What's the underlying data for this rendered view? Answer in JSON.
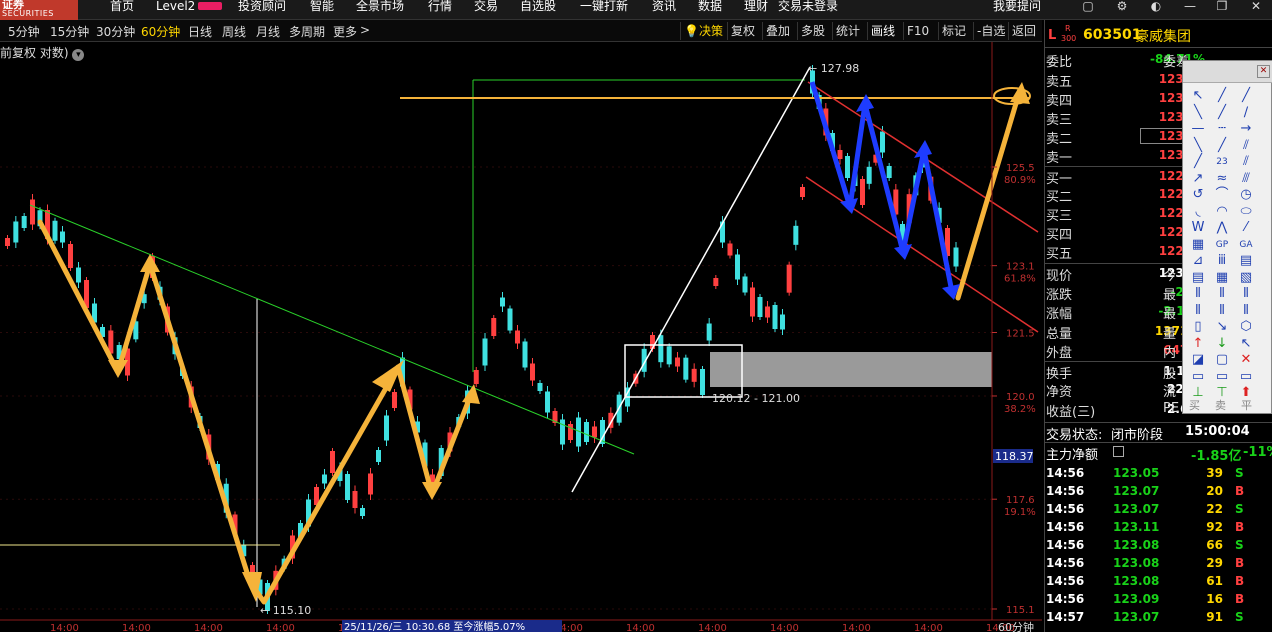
{
  "app": {
    "logo_line1": "证券",
    "logo_line2": "SECURITIES",
    "menu": [
      "首页",
      "Level2",
      "投资顾问",
      "智能",
      "全景市场",
      "行情",
      "交易",
      "自选股",
      "一键打新",
      "资讯",
      "数据",
      "理财",
      "交易未登录",
      "我要提问"
    ]
  },
  "toolbar": {
    "periods": [
      "5分钟",
      "15分钟",
      "30分钟",
      "60分钟",
      "日线",
      "周线",
      "月线",
      "多周期",
      "更多"
    ],
    "active_period": "60分钟",
    "more_arrow": ">",
    "right_buttons": [
      "决策",
      "复权",
      "叠加",
      "多股",
      "统计",
      "画线",
      "F10",
      "标记",
      "-自选",
      "返回"
    ],
    "active_right": "画线"
  },
  "chart": {
    "subtitle": "前复权 对数)",
    "annotations": {
      "high": "127.98",
      "low": "115.10",
      "box_range": "120.12 - 121.00",
      "current_price": "118.37",
      "cursor_info": "25/11/26/三 10:30.68 至今涨幅5.07%"
    },
    "price_axis": [
      {
        "price": "125.5",
        "pct": "80.9%"
      },
      {
        "price": "123.1",
        "pct": "61.8%"
      },
      {
        "price": "121.5",
        "pct": ""
      },
      {
        "price": "120.0",
        "pct": "38.2%"
      },
      {
        "price": "117.6",
        "pct": "19.1%"
      },
      {
        "price": "115.1",
        "pct": ""
      }
    ],
    "time_axis": [
      "14:00",
      "14:00",
      "14:00",
      "14:00",
      "14:00",
      "14:00",
      "14:00",
      "14:00",
      "14:00",
      "14:00",
      "14:00",
      "14:00",
      "14:00",
      "14:00"
    ],
    "period_label": "60分钟",
    "colors": {
      "up": "#ff4040",
      "down": "#3fe0e0",
      "arrow": "#f5b33a",
      "blue_arrow": "#1e3cff"
    }
  },
  "stock": {
    "badge_top": "R",
    "badge_bottom": "300",
    "market": "L",
    "code": "603501",
    "name": "豪威集团",
    "webi_label": "委比",
    "webi_value": "-84.71%",
    "webi_ext": "委差",
    "asks": [
      {
        "label": "卖五",
        "price": "123.04"
      },
      {
        "label": "卖四",
        "price": "123.03"
      },
      {
        "label": "卖三",
        "price": "123.02"
      },
      {
        "label": "卖二",
        "price": "123.01"
      },
      {
        "label": "卖一",
        "price": "123.00"
      }
    ],
    "bids": [
      {
        "label": "买一",
        "price": "122.99"
      },
      {
        "label": "买二",
        "price": "122.98"
      },
      {
        "label": "买三",
        "price": "122.95"
      },
      {
        "label": "买四",
        "price": "122.94"
      },
      {
        "label": "买五",
        "price": "122.93"
      }
    ],
    "stats": [
      {
        "label": "现价",
        "value": "123.00",
        "ext": "今",
        "color": "wht"
      },
      {
        "label": "涨跌",
        "value": "-2.74",
        "ext": "最",
        "color": "grn"
      },
      {
        "label": "涨幅",
        "value": "-2.18%",
        "ext": "最",
        "color": "grn"
      },
      {
        "label": "总量",
        "value": "137134",
        "ext": "量",
        "color": "yel"
      },
      {
        "label": "外盘",
        "value": "64761",
        "ext": "内",
        "color": "red"
      },
      {
        "label": "换手",
        "value": "1.13%",
        "ext": "股",
        "color": "wht"
      },
      {
        "label": "净资",
        "value": "22.77",
        "ext": "流",
        "color": "wht"
      },
      {
        "label": "收益(三)",
        "value": "2.670",
        "ext": "PE",
        "color": "wht"
      }
    ],
    "trade_status_label": "交易状态:",
    "trade_status_value": "闭市阶段",
    "trade_status_time": "15:00:04",
    "main_flow_label": "主力净额",
    "main_flow_value": "-1.85亿",
    "main_flow_pct": "-11%",
    "ticks": [
      {
        "time": "14:56",
        "price": "123.05",
        "vol": "39",
        "side": "S"
      },
      {
        "time": "14:56",
        "price": "123.07",
        "vol": "20",
        "side": "B"
      },
      {
        "time": "14:56",
        "price": "123.07",
        "vol": "22",
        "side": "S"
      },
      {
        "time": "14:56",
        "price": "123.11",
        "vol": "92",
        "side": "B"
      },
      {
        "time": "14:56",
        "price": "123.08",
        "vol": "66",
        "side": "S"
      },
      {
        "time": "14:56",
        "price": "123.08",
        "vol": "29",
        "side": "B"
      },
      {
        "time": "14:56",
        "price": "123.08",
        "vol": "61",
        "side": "B"
      },
      {
        "time": "14:56",
        "price": "123.09",
        "vol": "16",
        "side": "B"
      },
      {
        "time": "14:57",
        "price": "123.07",
        "vol": "91",
        "side": "S"
      }
    ]
  },
  "palette": {
    "footer": [
      "买",
      "卖",
      "平"
    ],
    "text_tools": [
      "23",
      "GP",
      "GA",
      "A"
    ]
  }
}
